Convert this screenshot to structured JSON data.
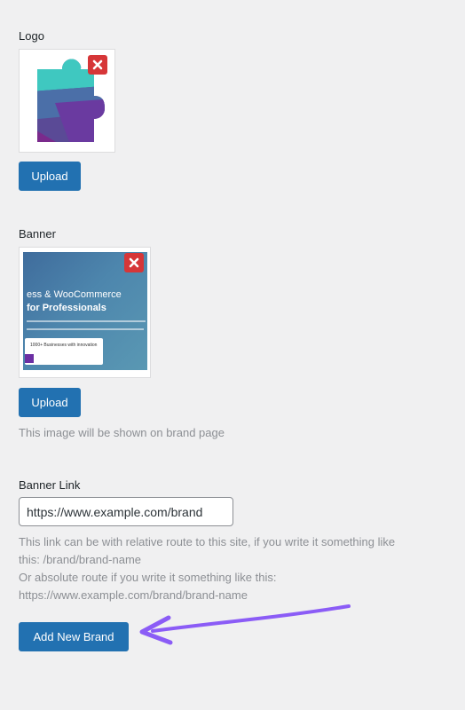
{
  "logo": {
    "label": "Logo",
    "upload_label": "Upload"
  },
  "banner": {
    "label": "Banner",
    "upload_label": "Upload",
    "description": "This image will be shown on brand page",
    "preview": {
      "line1": "ess & WooCommerce",
      "line2": "for Professionals",
      "card_text": "1000+ Businesses with innovation"
    }
  },
  "banner_link": {
    "label": "Banner Link",
    "value": "https://www.example.com/brand",
    "help_line1": "This link can be with relative route to this site, if you write it something like",
    "help_line2": "this: /brand/brand-name",
    "help_line3": "Or absolute route if you write it something like this:",
    "help_line4": "https://www.example.com/brand/brand-name"
  },
  "submit": {
    "label": "Add New Brand"
  },
  "colors": {
    "primary": "#2271b1",
    "remove": "#d63638",
    "annotation_arrow": "#8b5cf6"
  }
}
